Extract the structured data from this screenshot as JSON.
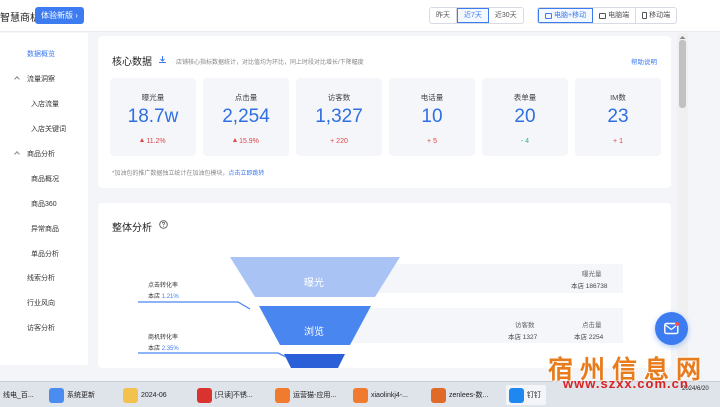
{
  "header": {
    "app_name": "智慧商机",
    "trial_button": "体验新版",
    "date_options": [
      "昨天",
      "近7天",
      "近30天"
    ],
    "date_selected": "近7天",
    "platform_options": [
      "电脑+移动",
      "电脑端",
      "移动端"
    ],
    "platform_selected": "电脑+移动"
  },
  "sidebar": {
    "items": [
      {
        "label": "数据概览",
        "active": true
      },
      {
        "label": "流量洞察",
        "group": true
      },
      {
        "label": "入店流量"
      },
      {
        "label": "入店关键词"
      },
      {
        "label": "商品分析",
        "group": true
      },
      {
        "label": "商品概况"
      },
      {
        "label": "商品360"
      },
      {
        "label": "异常商品"
      },
      {
        "label": "单品分析"
      },
      {
        "label": "线索分析"
      },
      {
        "label": "行业风向"
      },
      {
        "label": "访客分析"
      }
    ]
  },
  "core": {
    "title": "核心数据",
    "hint": "店铺核心指标数据统计，对比值均为环比，同上时段对比增长/下降幅度",
    "help": "帮助说明",
    "metrics": [
      {
        "label": "曝光量",
        "value": "18.7w",
        "delta": "11.2%",
        "dir": "up"
      },
      {
        "label": "点击量",
        "value": "2,254",
        "delta": "15.9%",
        "dir": "up"
      },
      {
        "label": "访客数",
        "value": "1,327",
        "delta": "+ 220",
        "dir": "plain"
      },
      {
        "label": "电话量",
        "value": "10",
        "delta": "+ 5",
        "dir": "plain"
      },
      {
        "label": "表单量",
        "value": "20",
        "delta": "- 4",
        "dir": "down"
      },
      {
        "label": "IM数",
        "value": "23",
        "delta": "+ 1",
        "dir": "plain"
      }
    ],
    "note_prefix": "*加油包的推广数据独立统计在加油包模块，",
    "note_link": "点击立即跳转"
  },
  "overall": {
    "title": "整体分析",
    "funnel": [
      {
        "stage": "曝光",
        "stats": [
          {
            "label": "曝光量",
            "value": "本店 186738"
          }
        ]
      },
      {
        "stage": "浏览",
        "stats": [
          {
            "label": "访客数",
            "value": "本店 1327"
          },
          {
            "label": "点击量",
            "value": "本店 2254"
          }
        ]
      }
    ],
    "conversions": [
      {
        "label": "点击转化率",
        "prefix": "本店",
        "pct": "1.21%"
      },
      {
        "label": "商机转化率",
        "prefix": "本店",
        "pct": "2.35%"
      }
    ]
  },
  "taskbar": {
    "items": [
      "线电_百...",
      "系统更新",
      "2024-06",
      "[只读]不锈...",
      "运营猫-应用...",
      "xiaolinkj4-...",
      "zenlees-数...",
      "钉钉"
    ],
    "clock_time": "",
    "clock_date": "2024/6/20"
  },
  "watermark": {
    "text": "宿州信息网",
    "url": "www.szxx.com.cn"
  },
  "colors": {
    "accent": "#3c7cf0",
    "up": "#e04545",
    "down": "#2bb673",
    "watermark": "#e87b1b"
  }
}
